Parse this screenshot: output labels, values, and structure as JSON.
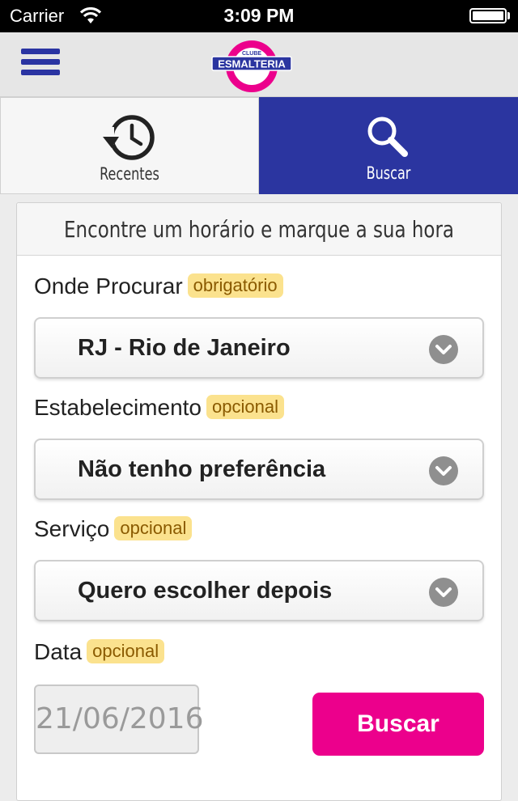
{
  "status_bar": {
    "carrier": "Carrier",
    "time": "3:09 PM"
  },
  "header": {
    "logo_top": "CLUBE",
    "logo_main": "ESMALTERIA",
    "menu_icon": "hamburger-menu-icon"
  },
  "tabs": [
    {
      "label": "Recentes",
      "icon": "history-clock-icon",
      "active": false
    },
    {
      "label": "Buscar",
      "icon": "search-icon",
      "active": true
    }
  ],
  "form": {
    "title": "Encontre um horário e marque a sua hora",
    "fields": [
      {
        "label": "Onde Procurar",
        "badge": "obrigatório",
        "value": "RJ - Rio de Janeiro"
      },
      {
        "label": "Estabelecimento",
        "badge": "opcional",
        "value": "Não tenho preferência"
      },
      {
        "label": "Serviço",
        "badge": "opcional",
        "value": "Quero escolher depois"
      }
    ],
    "date": {
      "label": "Data",
      "badge": "opcional",
      "value": "21/06/2016"
    },
    "submit_label": "Buscar"
  },
  "colors": {
    "brand_blue": "#2b35a0",
    "brand_pink": "#ec008c",
    "badge_bg": "#fbe28e"
  }
}
